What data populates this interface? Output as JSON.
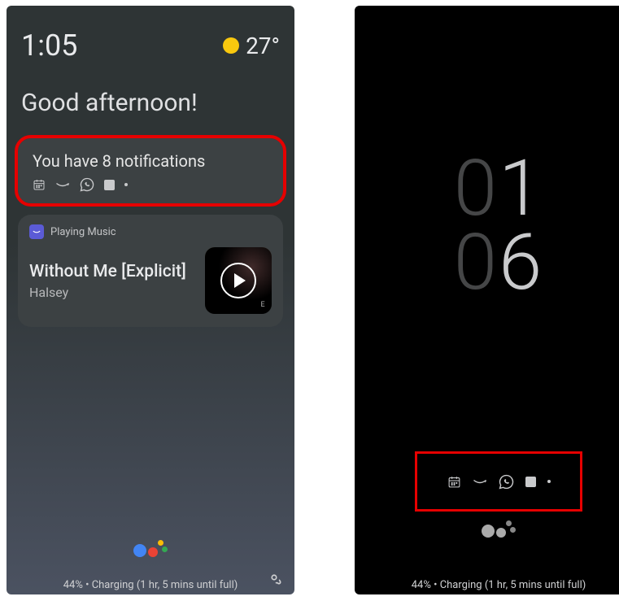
{
  "left": {
    "clock": "1:05",
    "weather_temp": "27°",
    "greeting": "Good afternoon!",
    "notif_card": {
      "title": "You have 8 notifications",
      "icons": [
        "calendar-icon",
        "amazon-icon",
        "whatsapp-icon",
        "square-icon",
        "dot-icon"
      ]
    },
    "music_card": {
      "app_label": "Playing Music",
      "track_title": "Without Me [Explicit]",
      "track_artist": "Halsey",
      "explicit_badge": "E"
    },
    "charging_text": "44% • Charging (1 hr, 5 mins until full)"
  },
  "right": {
    "clock_hh_tens": "0",
    "clock_hh_units": "1",
    "clock_mm_tens": "0",
    "clock_mm_units": "6",
    "icons": [
      "calendar-icon",
      "amazon-icon",
      "whatsapp-icon",
      "square-icon",
      "dot-icon"
    ],
    "charging_text": "44% • Charging (1 hr, 5 mins until full)"
  },
  "colors": {
    "highlight": "#e60000",
    "sun": "#f9c80e"
  }
}
